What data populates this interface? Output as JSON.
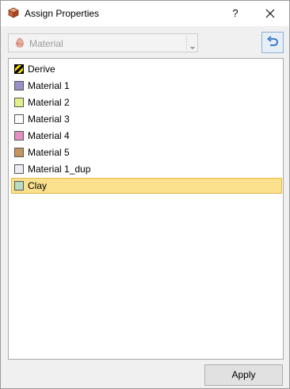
{
  "window": {
    "title": "Assign Properties",
    "help_label": "?"
  },
  "toolbar": {
    "dropdown": {
      "selected": "Material",
      "icon": "material-icon"
    },
    "refresh_icon": "undo-arrow-icon"
  },
  "list": {
    "items": [
      {
        "label": "Derive",
        "color": "#f5d800",
        "pattern": "hatched"
      },
      {
        "label": "Material 1",
        "color": "#9b8fc7"
      },
      {
        "label": "Material 2",
        "color": "#e4ef8a"
      },
      {
        "label": "Material 3",
        "color": "#fbfbfb"
      },
      {
        "label": "Material 4",
        "color": "#e68fc3"
      },
      {
        "label": "Material 5",
        "color": "#c8945e"
      },
      {
        "label": "Material 1_dup",
        "color": "#ecebf6"
      },
      {
        "label": "Clay",
        "color": "#b8dcc0",
        "selected": true
      }
    ]
  },
  "footer": {
    "apply_label": "Apply"
  },
  "colors": {
    "selection_fill": "#fbe08d",
    "selection_border": "#e0b948",
    "accent_blue": "#2b6cc4"
  }
}
